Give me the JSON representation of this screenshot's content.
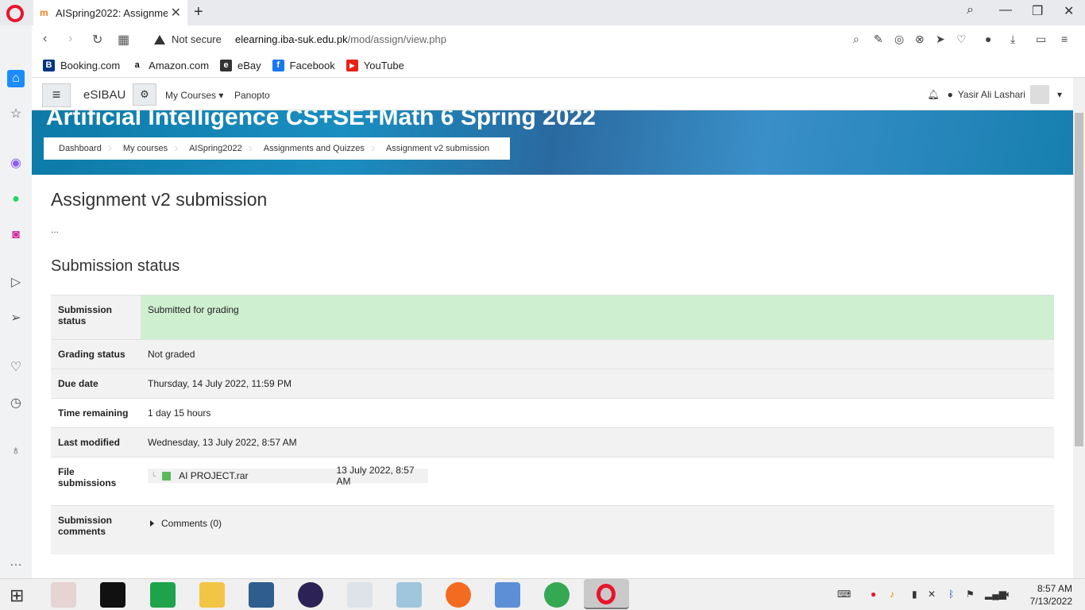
{
  "browser": {
    "tab_title": "AISpring2022: Assignment",
    "favicon": "m",
    "address_security": "Not secure",
    "url_domain": "elearning.iba-suk.edu.pk",
    "url_path": "/mod/assign/view.php",
    "bookmarks": [
      {
        "label": "Booking.com",
        "icon": "B",
        "color": "#003580"
      },
      {
        "label": "Amazon.com",
        "icon": "a",
        "color": "#111111"
      },
      {
        "label": "eBay",
        "icon": "e",
        "color": "#333333"
      },
      {
        "label": "Facebook",
        "icon": "f",
        "color": "#1877f2"
      },
      {
        "label": "YouTube",
        "icon": "▶",
        "color": "#e62117"
      }
    ]
  },
  "moodle_nav": {
    "brand": "eSIBAU",
    "my_courses": "My Courses",
    "panopto": "Panopto",
    "user_name": "Yasir Ali Lashari"
  },
  "hero": {
    "course_title": "Artificial Intelligence CS+SE+Math 6 Spring 2022",
    "breadcrumbs": [
      "Dashboard",
      "My courses",
      "AISpring2022",
      "Assignments and Quizzes",
      "Assignment v2 submission"
    ]
  },
  "main": {
    "heading": "Assignment v2 submission",
    "ellipsis": "...",
    "section_title": "Submission status",
    "rows": {
      "submission_status": {
        "label": "Submission status",
        "value": "Submitted for grading"
      },
      "grading_status": {
        "label": "Grading status",
        "value": "Not graded"
      },
      "due_date": {
        "label": "Due date",
        "value": "Thursday, 14 July 2022, 11:59 PM"
      },
      "time_remaining": {
        "label": "Time remaining",
        "value": "1 day 15 hours"
      },
      "last_modified": {
        "label": "Last modified",
        "value": "Wednesday, 13 July 2022, 8:57 AM"
      },
      "file_submissions": {
        "label": "File submissions",
        "file_name": "AI PROJECT.rar",
        "file_date": "13 July 2022, 8:57 AM"
      },
      "submission_comments": {
        "label": "Submission comments",
        "toggle": "Comments (0)"
      }
    }
  },
  "taskbar": {
    "time": "8:57 AM",
    "date": "7/13/2022"
  }
}
